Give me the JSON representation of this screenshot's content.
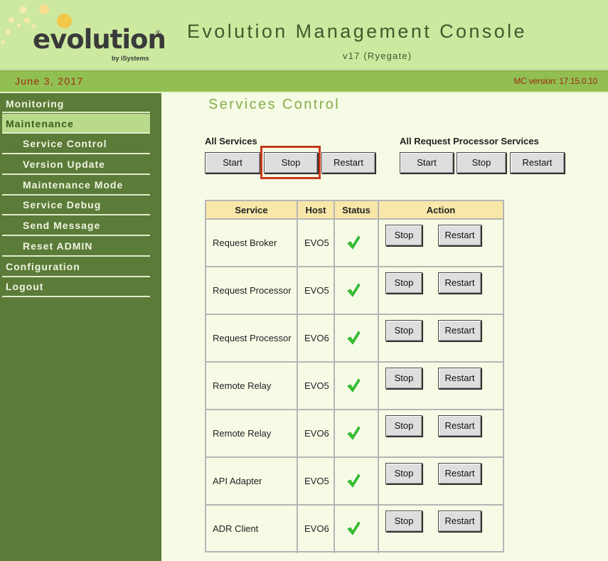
{
  "header": {
    "logo_word_start": "ev",
    "logo_word_o": "o",
    "logo_word_end": "lution",
    "logo_reg": "®",
    "logo_sub": "by iSystems",
    "title": "Evolution Management Console",
    "subtitle": "v17 (Ryegate)"
  },
  "infobar": {
    "date": "June 3, 2017",
    "mc_version": "MC version:  17.15.0.10"
  },
  "sidebar": {
    "items": [
      {
        "label": "Monitoring",
        "level": "top"
      },
      {
        "label": "Maintenance",
        "level": "top",
        "active": true
      },
      {
        "label": "Service Control",
        "level": "sub"
      },
      {
        "label": "Version Update",
        "level": "sub"
      },
      {
        "label": "Maintenance Mode",
        "level": "sub"
      },
      {
        "label": "Service Debug",
        "level": "sub"
      },
      {
        "label": "Send Message",
        "level": "sub"
      },
      {
        "label": "Reset ADMIN",
        "level": "sub"
      },
      {
        "label": "Configuration",
        "level": "top"
      },
      {
        "label": "Logout",
        "level": "top"
      }
    ]
  },
  "main": {
    "page_title": "Services Control",
    "all_services": {
      "label": "All Services",
      "start": "Start",
      "stop": "Stop",
      "restart": "Restart"
    },
    "all_rp_services": {
      "label": "All Request Processor Services",
      "start": "Start",
      "stop": "Stop",
      "restart": "Restart"
    },
    "table": {
      "headers": [
        "Service",
        "Host",
        "Status",
        "Action"
      ],
      "rows": [
        {
          "service": "Request Broker",
          "host": "EVO5",
          "status": "ok",
          "stop": "Stop",
          "restart": "Restart"
        },
        {
          "service": "Request Processor",
          "host": "EVO5",
          "status": "ok",
          "stop": "Stop",
          "restart": "Restart"
        },
        {
          "service": "Request Processor",
          "host": "EVO6",
          "status": "ok",
          "stop": "Stop",
          "restart": "Restart"
        },
        {
          "service": "Remote Relay",
          "host": "EVO5",
          "status": "ok",
          "stop": "Stop",
          "restart": "Restart"
        },
        {
          "service": "Remote Relay",
          "host": "EVO6",
          "status": "ok",
          "stop": "Stop",
          "restart": "Restart"
        },
        {
          "service": "API Adapter",
          "host": "EVO5",
          "status": "ok",
          "stop": "Stop",
          "restart": "Restart"
        },
        {
          "service": "ADR Client",
          "host": "EVO6",
          "status": "ok",
          "stop": "Stop",
          "restart": "Restart"
        }
      ]
    }
  },
  "colors": {
    "header_bg": "#cde9a0",
    "infobar_bg": "#91bf51",
    "sidebar_bg": "#5b7b38",
    "accent_text": "#9a2b14",
    "highlight": "#c8381b",
    "check_green": "#33cc33"
  }
}
